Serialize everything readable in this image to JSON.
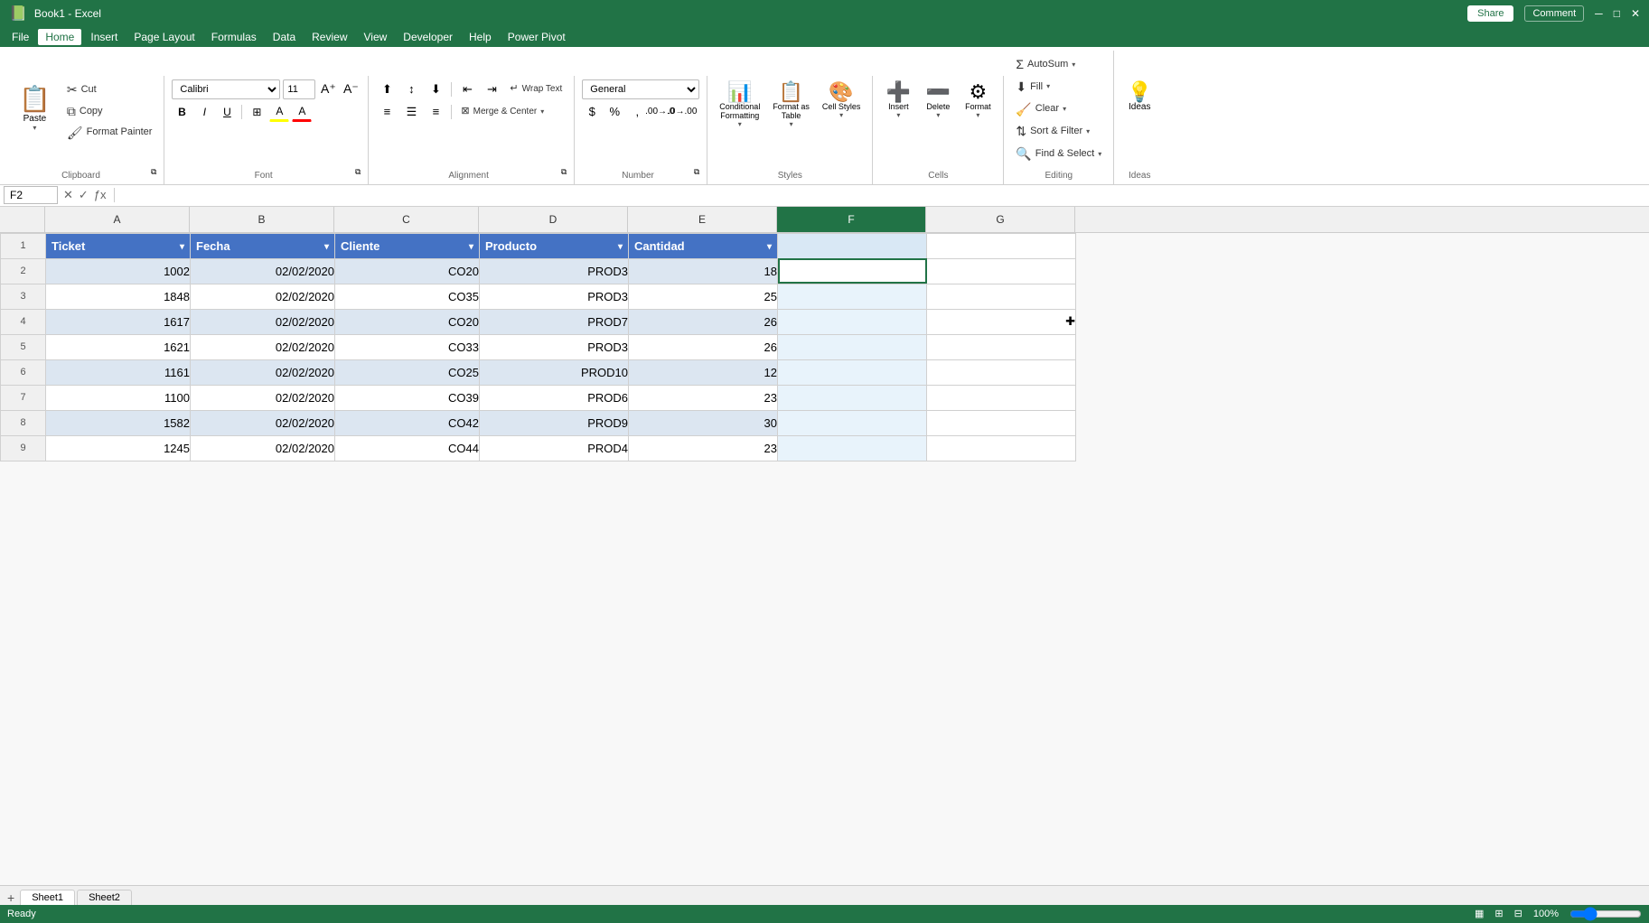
{
  "titleBar": {
    "filename": "Book1 - Excel",
    "shareBtn": "Share",
    "commentBtn": "Comment"
  },
  "menuBar": {
    "items": [
      "File",
      "Home",
      "Insert",
      "Page Layout",
      "Formulas",
      "Data",
      "Review",
      "View",
      "Developer",
      "Help",
      "Power Pivot"
    ]
  },
  "ribbon": {
    "groups": [
      {
        "name": "Clipboard",
        "label": "Clipboard",
        "paste": "Paste",
        "cut": "Cut",
        "copy": "Copy",
        "formatPainter": "Format Painter"
      },
      {
        "name": "Font",
        "label": "Font",
        "fontName": "Calibri",
        "fontSize": "11",
        "bold": "B",
        "italic": "I",
        "underline": "U"
      },
      {
        "name": "Alignment",
        "label": "Alignment",
        "wrapText": "Wrap Text",
        "mergeCenter": "Merge & Center"
      },
      {
        "name": "Number",
        "label": "Number",
        "format": "General"
      },
      {
        "name": "Styles",
        "label": "Styles",
        "conditional": "Conditional Formatting",
        "formatTable": "Format as Table",
        "cellStyles": "Cell Styles"
      },
      {
        "name": "Cells",
        "label": "Cells",
        "insert": "Insert",
        "delete": "Delete",
        "format": "Format"
      },
      {
        "name": "Editing",
        "label": "Editing",
        "autoSum": "AutoSum",
        "fill": "Fill",
        "clear": "Clear",
        "sortFilter": "Sort & Filter",
        "findSelect": "Find & Select"
      },
      {
        "name": "Ideas",
        "label": "Ideas",
        "ideas": "Ideas"
      }
    ]
  },
  "formulaBar": {
    "cellRef": "F2",
    "formula": ""
  },
  "columns": {
    "headers": [
      "A",
      "B",
      "C",
      "D",
      "E",
      "F",
      "G"
    ],
    "widths": [
      160,
      160,
      160,
      165,
      165,
      165,
      165
    ]
  },
  "table": {
    "headers": [
      "Ticket",
      "Fecha",
      "Cliente",
      "Producto",
      "Cantidad"
    ],
    "rows": [
      [
        "1002",
        "02/02/2020",
        "CO20",
        "PROD3",
        "18"
      ],
      [
        "1848",
        "02/02/2020",
        "CO35",
        "PROD3",
        "25"
      ],
      [
        "1617",
        "02/02/2020",
        "CO20",
        "PROD7",
        "26"
      ],
      [
        "1621",
        "02/02/2020",
        "CO33",
        "PROD3",
        "26"
      ],
      [
        "1161",
        "02/02/2020",
        "CO25",
        "PROD10",
        "12"
      ],
      [
        "1100",
        "02/02/2020",
        "CO39",
        "PROD6",
        "23"
      ],
      [
        "1582",
        "02/02/2020",
        "CO42",
        "PROD9",
        "30"
      ],
      [
        "1245",
        "02/02/2020",
        "CO44",
        "PROD4",
        "23"
      ]
    ]
  },
  "sheets": [
    "Sheet1",
    "Sheet2"
  ],
  "activeSheet": "Sheet1",
  "statusBar": {
    "mode": "Ready",
    "zoom": "100%"
  }
}
